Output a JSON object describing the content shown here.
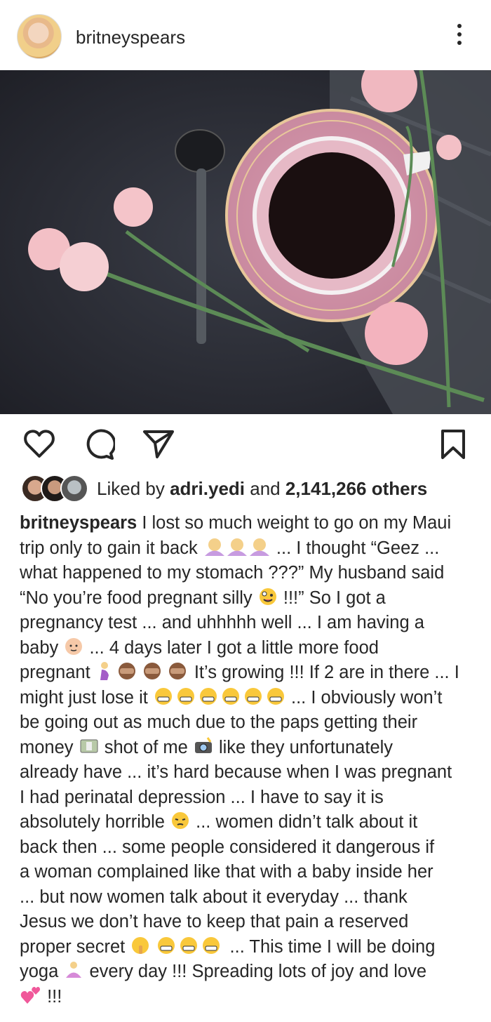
{
  "header": {
    "username": "britneyspears"
  },
  "likes": {
    "prefix": "Liked by ",
    "user": "adri.yedi",
    "middle": " and ",
    "count": "2,141,266 others"
  },
  "caption": {
    "username": "britneyspears",
    "lines": [
      " I lost so much weight to go on my Maui",
      "trip only to gain it back",
      " ... I thought “Geez ...",
      "what happened to my stomach ???” My husband said",
      "“No you’re food pregnant silly",
      " !!!” So I got a",
      "pregnancy test ... and uhhhhh well ... I am having a",
      "baby",
      " ... 4 days later I got a little more food",
      "pregnant",
      " It’s growing !!! If 2 are in there ... I",
      "might just lose it",
      " ... I obviously won’t",
      "be going out as much due to the paps getting their",
      "money",
      " shot of me",
      " like they unfortunately",
      "already have ... it’s hard because when I was pregnant",
      "I had perinatal depression ... I have to say it is",
      "absolutely horrible",
      " ... women didn’t talk about it",
      "back then ... some people considered it dangerous if",
      "a woman complained like that with a baby inside her",
      "... but now women talk about it everyday ... thank",
      "Jesus we don’t have to keep that pain a reserved",
      "proper secret",
      " ... This time I will be doing",
      "yoga",
      " every day !!! Spreading lots of joy and love",
      " !!!"
    ]
  },
  "icons": {
    "like": "heart-icon",
    "comment": "comment-icon",
    "share": "send-icon",
    "save": "bookmark-icon",
    "more": "more-vertical-icon"
  },
  "colors": {
    "text": "#262626",
    "background": "#ffffff"
  }
}
